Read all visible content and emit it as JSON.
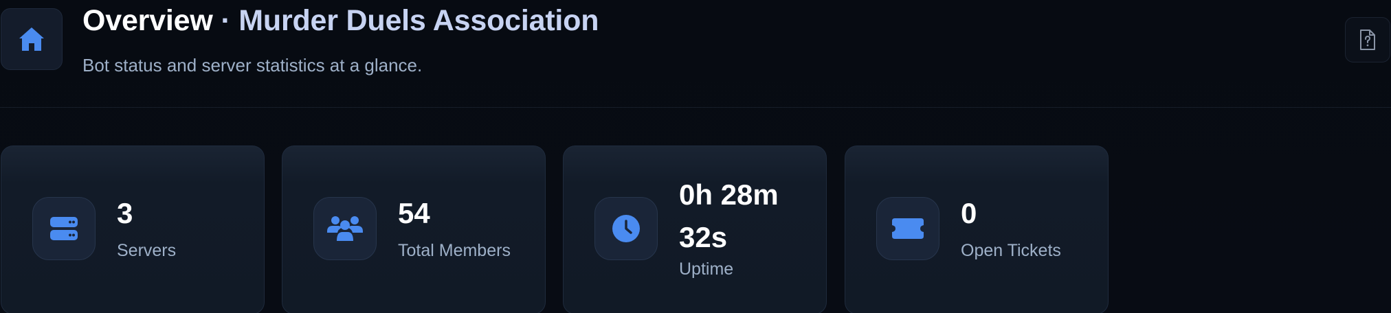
{
  "header": {
    "title_main": "Overview",
    "title_separator": " · ",
    "title_org": "Murder Duels Association",
    "subtitle": "Bot status and server statistics at a glance.",
    "home_icon": "home-icon",
    "help_icon": "file-question-icon"
  },
  "stats": [
    {
      "value": "3",
      "label": "Servers",
      "icon": "server-icon"
    },
    {
      "value": "54",
      "label": "Total Members",
      "icon": "users-icon"
    },
    {
      "value": "0h 28m 32s",
      "label": "Uptime",
      "icon": "clock-icon"
    },
    {
      "value": "0",
      "label": "Open Tickets",
      "icon": "ticket-icon"
    }
  ],
  "colors": {
    "accent": "#4a8bf0",
    "background": "#070b12",
    "card": "#121b28",
    "text_muted": "#9eb0c8",
    "title_secondary": "#c7d3f2"
  }
}
